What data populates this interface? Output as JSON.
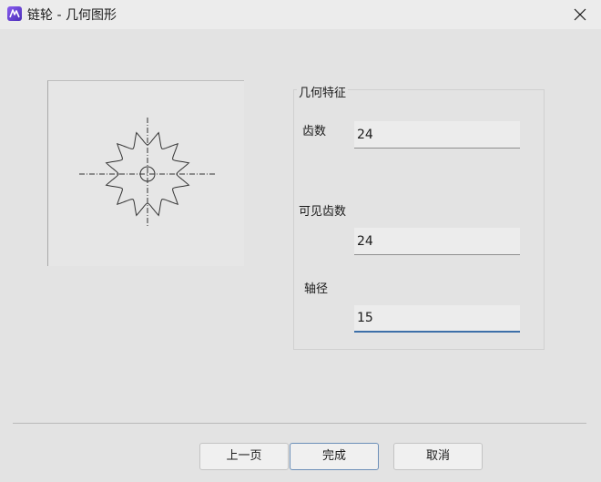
{
  "window": {
    "title": "链轮 - 几何图形"
  },
  "preview": {
    "teeth_shown": 12
  },
  "geometry": {
    "group_title": "几何特征",
    "fields": [
      {
        "label": "齿数",
        "value": "24"
      },
      {
        "label": "可见齿数",
        "value": "24"
      },
      {
        "label": "轴径",
        "value": "15"
      }
    ]
  },
  "buttons": {
    "prev": "上一页",
    "finish": "完成",
    "cancel": "取消"
  },
  "colors": {
    "accent": "#3d6fa8",
    "icon_purple": "#6a3fd8"
  }
}
